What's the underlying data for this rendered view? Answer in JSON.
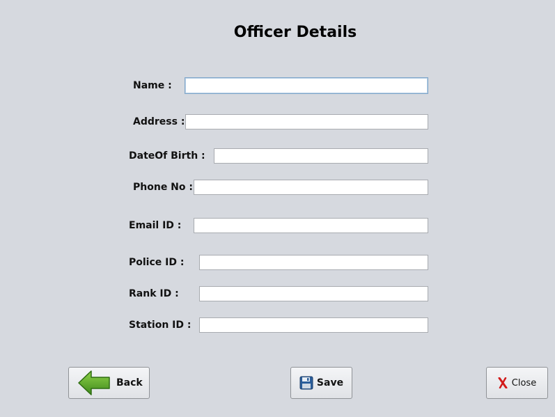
{
  "form": {
    "title": "Officer Details",
    "fields": {
      "name": {
        "label": "Name :",
        "value": ""
      },
      "address": {
        "label": "Address :",
        "value": ""
      },
      "dob": {
        "label": "DateOf Birth :",
        "value": ""
      },
      "phone": {
        "label": "Phone No :",
        "value": ""
      },
      "email": {
        "label": "Email ID :",
        "value": ""
      },
      "police_id": {
        "label": "Police ID :",
        "value": ""
      },
      "rank_id": {
        "label": "Rank ID :",
        "value": ""
      },
      "station_id": {
        "label": "Station ID :",
        "value": ""
      }
    }
  },
  "buttons": {
    "back": {
      "label": "Back",
      "icon": "arrow-left-icon"
    },
    "save": {
      "label": "Save",
      "icon": "floppy-disk-icon"
    },
    "close": {
      "label": "Close",
      "icon": "close-x-icon"
    }
  },
  "colors": {
    "background": "#d6d9df",
    "back_arrow": "#5fa52c",
    "save_icon": "#2a5d9a",
    "close_icon": "#d21a1a"
  }
}
